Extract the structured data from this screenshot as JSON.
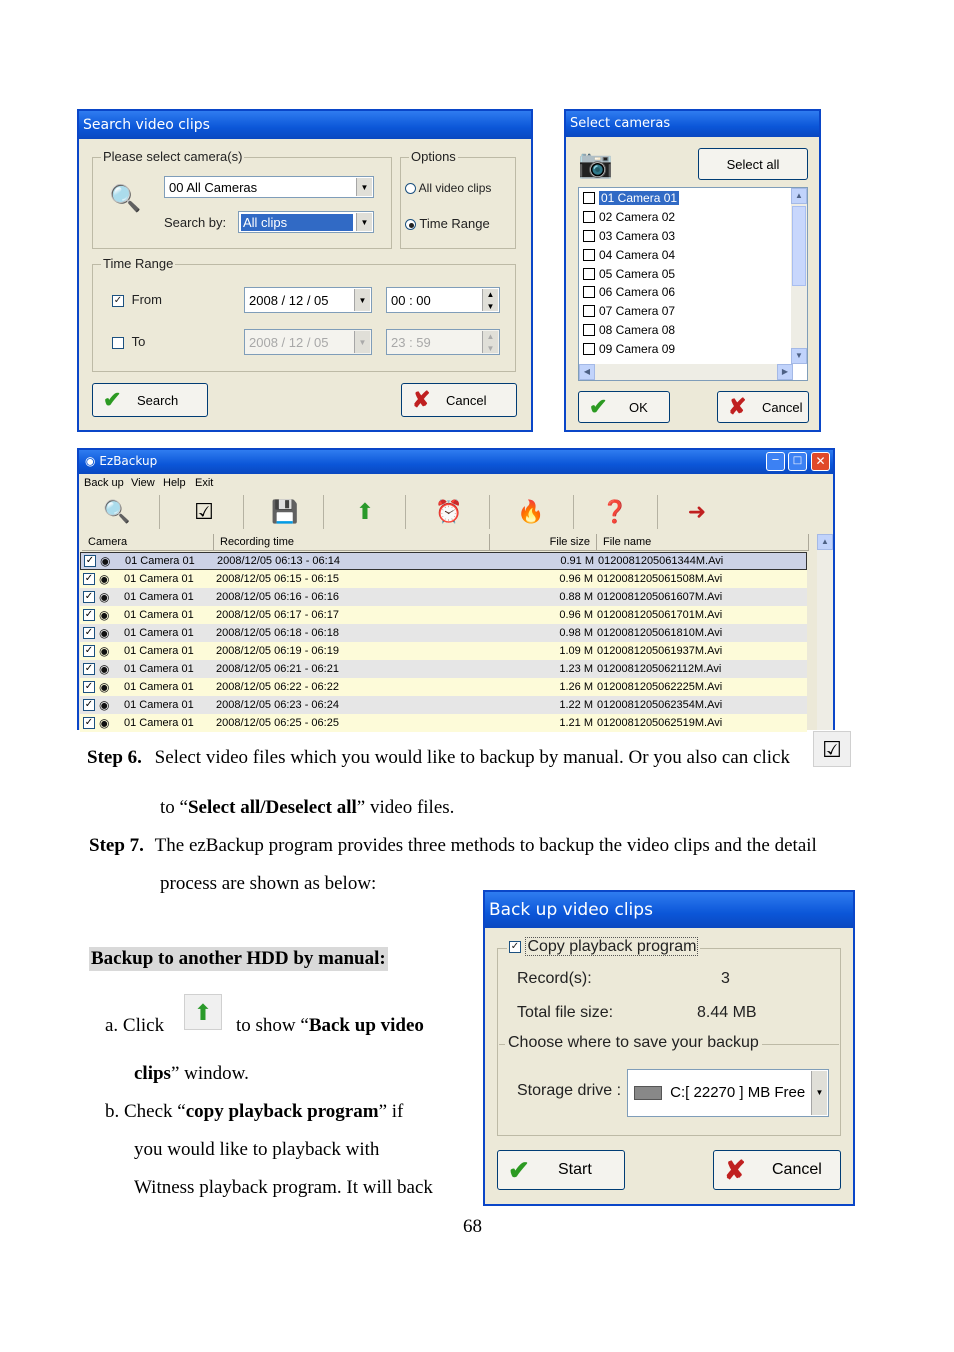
{
  "search_dialog": {
    "title": "Search video clips",
    "camera_group": "Please select camera(s)",
    "camera_value": "00 All Cameras",
    "search_by_label": "Search by:",
    "search_by_value": "All clips",
    "options_group": "Options",
    "opt_all": "All video clips",
    "opt_range": "Time Range",
    "time_group": "Time Range",
    "from_label": "From",
    "from_date": "2008 / 12 / 05",
    "from_time": "00  :  00",
    "to_label": "To",
    "to_date": "2008 / 12 / 05",
    "to_time": "23  :  59",
    "search_btn": "Search",
    "cancel_btn": "Cancel"
  },
  "select_cameras": {
    "title": "Select cameras",
    "select_all": "Select all",
    "cameras": [
      "01 Camera 01",
      "02 Camera 02",
      "03 Camera 03",
      "04 Camera 04",
      "05 Camera 05",
      "06 Camera 06",
      "07 Camera 07",
      "08 Camera 08",
      "09 Camera 09"
    ],
    "ok_btn": "OK",
    "cancel_btn": "Cancel"
  },
  "ezbackup": {
    "title": "EzBackup",
    "menu": [
      "Back up",
      "View",
      "Help",
      "Exit"
    ],
    "columns": [
      "Camera",
      "Recording time",
      "File size",
      "File name"
    ],
    "rows": [
      {
        "camera": "01 Camera 01",
        "time": "2008/12/05 06:13 - 06:14",
        "size": "0.91 M",
        "file": "0120081205061344M.Avi"
      },
      {
        "camera": "01 Camera 01",
        "time": "2008/12/05 06:15 - 06:15",
        "size": "0.96 M",
        "file": "0120081205061508M.Avi"
      },
      {
        "camera": "01 Camera 01",
        "time": "2008/12/05 06:16 - 06:16",
        "size": "0.88 M",
        "file": "0120081205061607M.Avi"
      },
      {
        "camera": "01 Camera 01",
        "time": "2008/12/05 06:17 - 06:17",
        "size": "0.96 M",
        "file": "0120081205061701M.Avi"
      },
      {
        "camera": "01 Camera 01",
        "time": "2008/12/05 06:18 - 06:18",
        "size": "0.98 M",
        "file": "0120081205061810M.Avi"
      },
      {
        "camera": "01 Camera 01",
        "time": "2008/12/05 06:19 - 06:19",
        "size": "1.09 M",
        "file": "0120081205061937M.Avi"
      },
      {
        "camera": "01 Camera 01",
        "time": "2008/12/05 06:21 - 06:21",
        "size": "1.23 M",
        "file": "0120081205062112M.Avi"
      },
      {
        "camera": "01 Camera 01",
        "time": "2008/12/05 06:22 - 06:22",
        "size": "1.26 M",
        "file": "0120081205062225M.Avi"
      },
      {
        "camera": "01 Camera 01",
        "time": "2008/12/05 06:23 - 06:24",
        "size": "1.22 M",
        "file": "0120081205062354M.Avi"
      },
      {
        "camera": "01 Camera 01",
        "time": "2008/12/05 06:25 - 06:25",
        "size": "1.21 M",
        "file": "0120081205062519M.Avi"
      }
    ]
  },
  "doc": {
    "step6_label": "Step 6.",
    "step6_text": "Select video files which you would like to backup by manual. Or you also can click",
    "step6_cont_pre": "to “",
    "step6_cont_bold": "Select all/Deselect all",
    "step6_cont_post": "” video files.",
    "step7_label": "Step 7.",
    "step7_text": "The ezBackup program provides three methods to backup the video clips and the detail",
    "step7_cont": "process are shown as below:",
    "section_title": "Backup to another HDD by manual:",
    "a_prefix": "a.   Click",
    "a_mid": "to show “",
    "a_bold1": "Back up video",
    "a_bold2": "clips",
    "a_end": "” window.",
    "b_prefix": "b.   Check “",
    "b_bold": "copy playback program",
    "b_end": "” if",
    "b_line2": "you would like to playback with",
    "b_line3": "Witness playback program. It will back",
    "page_number": "68"
  },
  "backup_dialog": {
    "title": "Back up video clips",
    "copy_label": "Copy playback program",
    "records_label": "Record(s):",
    "records_value": "3",
    "total_label": "Total file size:",
    "total_value": "8.44 MB",
    "choose_label": "Choose where to save your backup",
    "storage_label": "Storage drive :",
    "storage_value": "C:[ 22270 ] MB Free",
    "start_btn": "Start",
    "cancel_btn": "Cancel"
  }
}
